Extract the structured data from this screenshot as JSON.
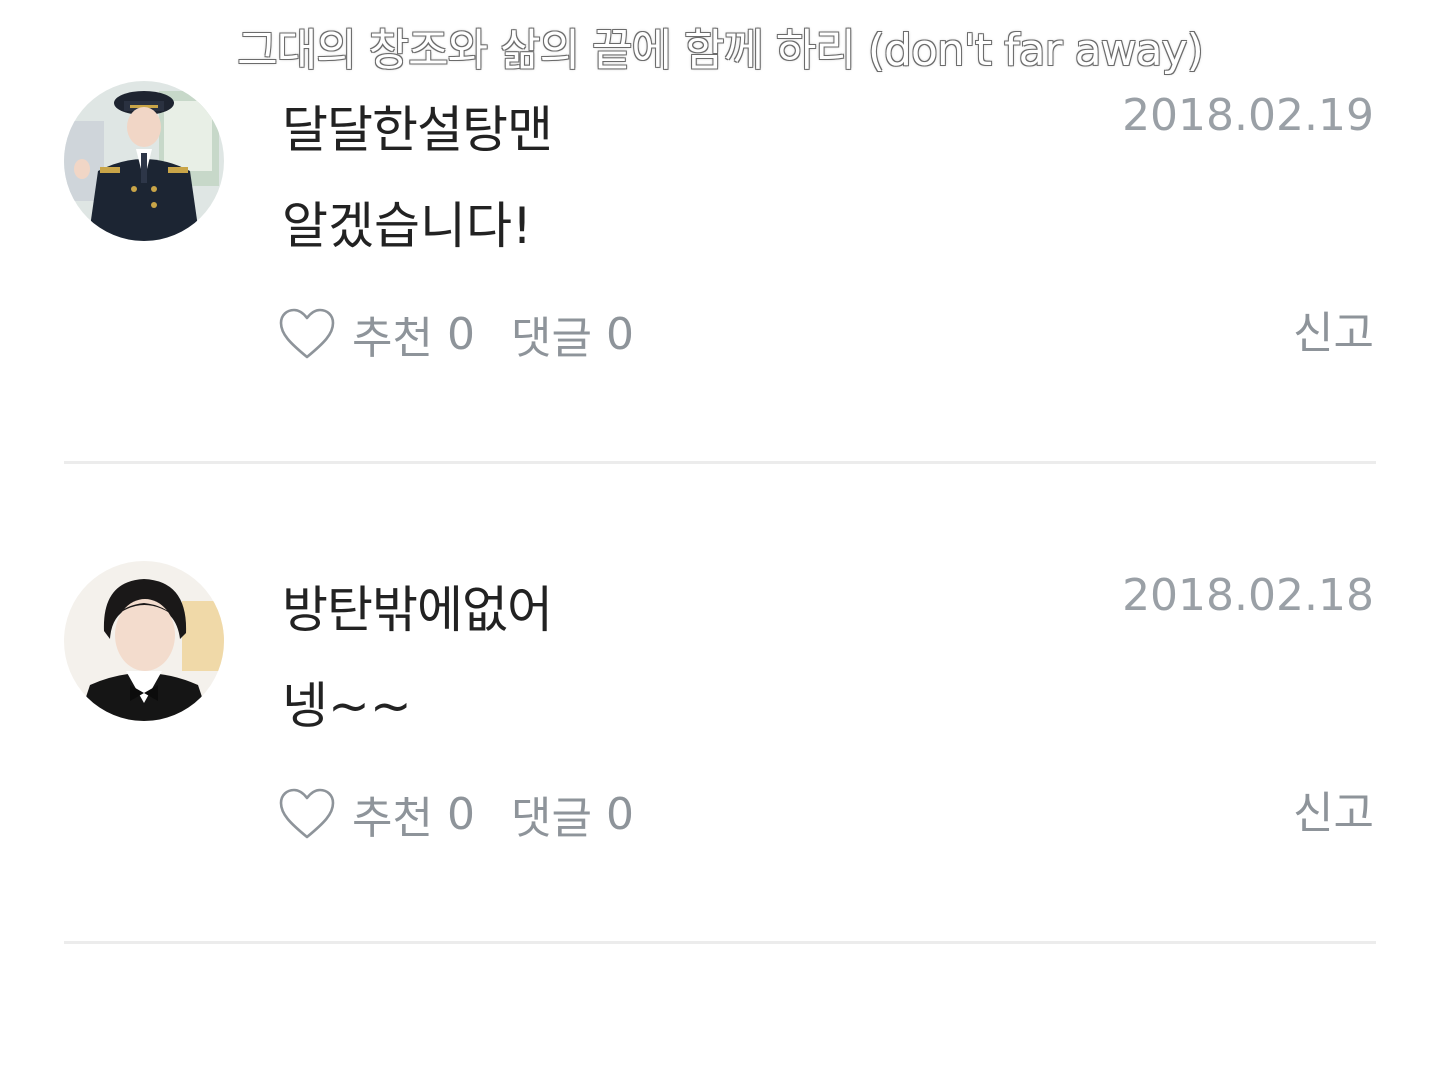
{
  "header": {
    "title": "그대의 창조와 삶의 끝에 함께 하리 (don't far away)"
  },
  "comments": [
    {
      "username": "달달한설탕맨",
      "date": "2018.02.19",
      "text": "알겠습니다!",
      "like_label": "추천",
      "like_count": "0",
      "reply_label": "댓글",
      "reply_count": "0",
      "report_label": "신고",
      "avatar_icon": "avatar-photo"
    },
    {
      "username": "방탄밖에없어",
      "date": "2018.02.18",
      "text": "넹~~",
      "like_label": "추천",
      "like_count": "0",
      "reply_label": "댓글",
      "reply_count": "0",
      "report_label": "신고",
      "avatar_icon": "avatar-photo"
    }
  ],
  "colors": {
    "text_primary": "#222222",
    "text_muted": "#8e949a",
    "date": "#9aa0a6",
    "divider": "#ececec",
    "background": "#ffffff"
  }
}
